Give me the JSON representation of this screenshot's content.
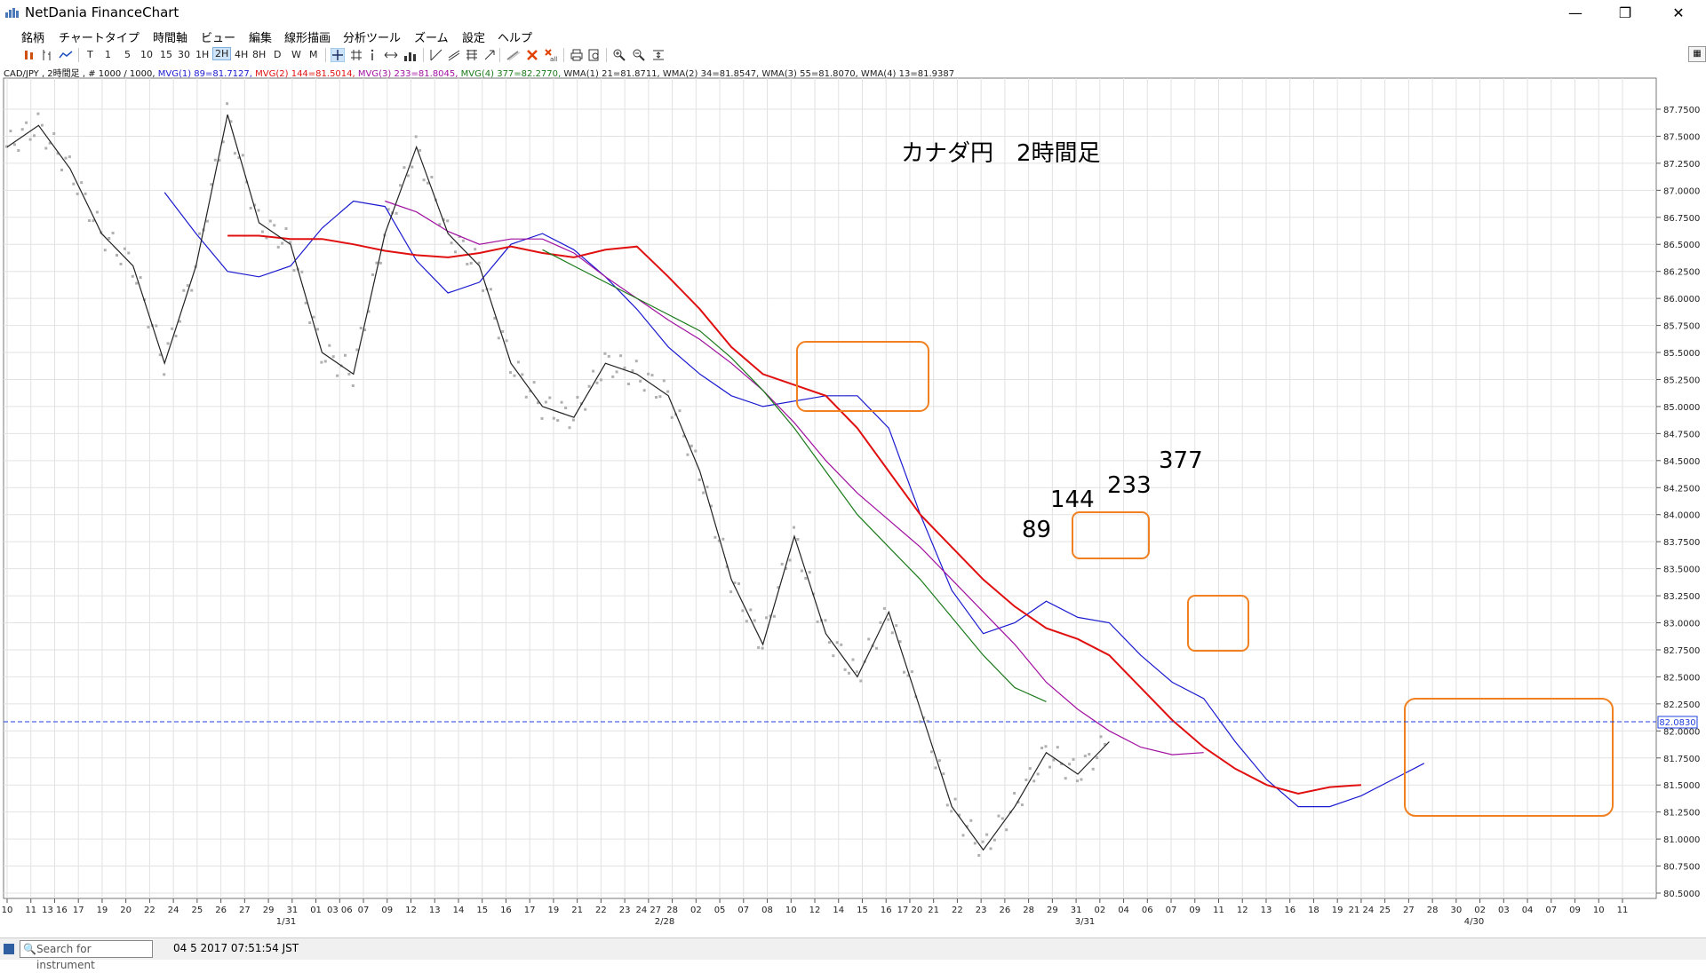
{
  "window": {
    "title": "NetDania FinanceChart",
    "minimize_glyph": "—",
    "maximize_glyph": "❐",
    "close_glyph": "✕"
  },
  "menu": [
    "銘柄",
    "チャートタイプ",
    "時間軸",
    "ビュー",
    "編集",
    "線形描画",
    "分析ツール",
    "ズーム",
    "設定",
    "ヘルプ"
  ],
  "toolbar": {
    "timeframes": [
      "T",
      "1",
      "5",
      "10",
      "15",
      "30",
      "1H",
      "2H",
      "4H",
      "8H",
      "D",
      "W",
      "M"
    ],
    "selected": "2H",
    "tools": [
      "crosshair-icon",
      "grid-icon",
      "info-icon",
      "pan-icon",
      "volume-icon",
      "trendline-icon",
      "channel-icon",
      "fibonacci-icon",
      "arrow-icon",
      "pencil-icon",
      "delete-icon",
      "delete-all-icon",
      "print-icon",
      "preview-icon",
      "zoom-in-icon",
      "zoom-out-icon",
      "zoom-fit-icon"
    ]
  },
  "legend": {
    "symbol": "CAD/JPY , 2時間足 , # 1000 / 1000,",
    "items": [
      {
        "text": "MVG(1) 89=81.7127,",
        "color": "#1a1ad0"
      },
      {
        "text": "MVG(2) 144=81.5014,",
        "color": "#e01010"
      },
      {
        "text": "MVG(3) 233=81.8045,",
        "color": "#a010a0"
      },
      {
        "text": "MVG(4) 377=82.2770,",
        "color": "#1a7a1a"
      },
      {
        "text": "WMA(1) 21=81.8711, WMA(2) 34=81.8547, WMA(3) 55=81.8070, WMA(4) 13=81.9387",
        "color": "#222222"
      }
    ]
  },
  "annotations": {
    "title": "カナダ円　2時間足",
    "labels": [
      "89",
      "144",
      "233",
      "377"
    ]
  },
  "chart_data": {
    "type": "line",
    "symbol": "CAD/JPY",
    "interval": "2H",
    "ylim": [
      80.5,
      87.8
    ],
    "y_ticks": [
      "87.7500",
      "87.5000",
      "87.2500",
      "87.0000",
      "86.7500",
      "86.5000",
      "86.2500",
      "86.0000",
      "85.7500",
      "85.5000",
      "85.2500",
      "85.0000",
      "84.7500",
      "84.5000",
      "84.2500",
      "84.0000",
      "83.7500",
      "83.5000",
      "83.2500",
      "83.0000",
      "82.7500",
      "82.5000",
      "82.2500",
      "82.0000",
      "81.7500",
      "81.5000",
      "81.2500",
      "81.0000",
      "80.7500",
      "80.5000"
    ],
    "x_ticks": [
      "10",
      "11",
      "13 16",
      "17",
      "19",
      "20",
      "22",
      "24",
      "25",
      "26",
      "27",
      "29",
      "31",
      "01",
      "03 06",
      "07",
      "09",
      "12",
      "13",
      "14",
      "15",
      "16",
      "17",
      "19",
      "21",
      "22",
      "23",
      "24 27",
      "28",
      "02",
      "05",
      "07",
      "08",
      "10",
      "12",
      "14",
      "15",
      "16",
      "17 20",
      "21",
      "22",
      "23",
      "26",
      "28",
      "29",
      "31",
      "02",
      "04",
      "06",
      "07",
      "09",
      "11",
      "12",
      "13",
      "16",
      "18",
      "19",
      "21 24",
      "25",
      "27",
      "28",
      "30",
      "02",
      "03",
      "04",
      "07",
      "09",
      "10",
      "11"
    ],
    "month_labels": [
      "1/31",
      "2/28",
      "3/31",
      "4/30"
    ],
    "current_price": "82.0830",
    "x": [
      0,
      20,
      40,
      60,
      80,
      100,
      120,
      140,
      160,
      180,
      200,
      220,
      240,
      260,
      280,
      300,
      320,
      340,
      360,
      380,
      400,
      420,
      440,
      460,
      480,
      500,
      520,
      540,
      560,
      580,
      600,
      620,
      640,
      660,
      680,
      700,
      720,
      740,
      760,
      780,
      800,
      820,
      840,
      860,
      880,
      900,
      920,
      940,
      960,
      980,
      1000
    ],
    "series": [
      {
        "name": "MVG(1) 89",
        "color": "#1a1ad0",
        "values": [
          null,
          null,
          null,
          null,
          null,
          86.98,
          86.6,
          86.25,
          86.2,
          86.3,
          86.65,
          86.9,
          86.85,
          86.35,
          86.05,
          86.15,
          86.5,
          86.6,
          86.45,
          86.2,
          85.9,
          85.55,
          85.3,
          85.1,
          85.0,
          85.05,
          85.1,
          85.1,
          84.8,
          84.0,
          83.3,
          82.9,
          83.0,
          83.2,
          83.05,
          83.0,
          82.7,
          82.45,
          82.3,
          81.9,
          81.55,
          81.3,
          81.3,
          81.4,
          81.55,
          81.7,
          null,
          null,
          null,
          null,
          null
        ]
      },
      {
        "name": "MVG(2) 144",
        "color": "#e01010",
        "values": [
          null,
          null,
          null,
          null,
          null,
          null,
          null,
          86.58,
          86.58,
          86.55,
          86.55,
          86.5,
          86.44,
          86.4,
          86.38,
          86.42,
          86.48,
          86.42,
          86.38,
          86.45,
          86.48,
          86.2,
          85.9,
          85.55,
          85.3,
          85.2,
          85.1,
          84.8,
          84.4,
          84.0,
          83.7,
          83.4,
          83.15,
          82.95,
          82.85,
          82.7,
          82.4,
          82.1,
          81.85,
          81.65,
          81.5,
          81.42,
          81.48,
          81.5,
          null,
          null,
          null,
          null,
          null,
          null,
          null
        ]
      },
      {
        "name": "MVG(3) 233",
        "color": "#a010a0",
        "values": [
          null,
          null,
          null,
          null,
          null,
          null,
          null,
          null,
          null,
          null,
          null,
          null,
          86.9,
          86.8,
          86.62,
          86.5,
          86.55,
          86.55,
          86.42,
          86.2,
          86.0,
          85.8,
          85.62,
          85.4,
          85.15,
          84.85,
          84.5,
          84.2,
          83.95,
          83.7,
          83.4,
          83.1,
          82.8,
          82.45,
          82.2,
          82.0,
          81.85,
          81.78,
          81.8,
          null,
          null,
          null,
          null,
          null,
          null,
          null,
          null,
          null,
          null,
          null,
          null
        ]
      },
      {
        "name": "MVG(4) 377",
        "color": "#1a7a1a",
        "values": [
          null,
          null,
          null,
          null,
          null,
          null,
          null,
          null,
          null,
          null,
          null,
          null,
          null,
          null,
          null,
          null,
          null,
          86.45,
          86.3,
          86.15,
          86.0,
          85.85,
          85.7,
          85.45,
          85.15,
          84.8,
          84.4,
          84.0,
          83.7,
          83.4,
          83.05,
          82.7,
          82.4,
          82.27,
          null,
          null,
          null,
          null,
          null,
          null,
          null,
          null,
          null,
          null,
          null,
          null,
          null,
          null,
          null,
          null,
          null
        ]
      },
      {
        "name": "WMA(4) 13",
        "color": "#222222",
        "values": [
          87.4,
          87.6,
          87.2,
          86.6,
          86.3,
          85.4,
          86.3,
          87.7,
          86.7,
          86.5,
          85.5,
          85.3,
          86.6,
          87.4,
          86.6,
          86.3,
          85.4,
          85.0,
          84.9,
          85.4,
          85.3,
          85.1,
          84.4,
          83.4,
          82.8,
          83.8,
          82.9,
          82.5,
          83.1,
          82.2,
          81.3,
          80.9,
          81.3,
          81.8,
          81.6,
          81.9,
          null,
          null,
          null,
          null,
          null,
          null,
          null,
          null,
          null,
          null,
          null,
          null,
          null,
          null,
          null
        ]
      }
    ]
  },
  "status": {
    "search_placeholder": "Search for instrument",
    "datetime": "04 5 2017 07:51:54 JST"
  }
}
